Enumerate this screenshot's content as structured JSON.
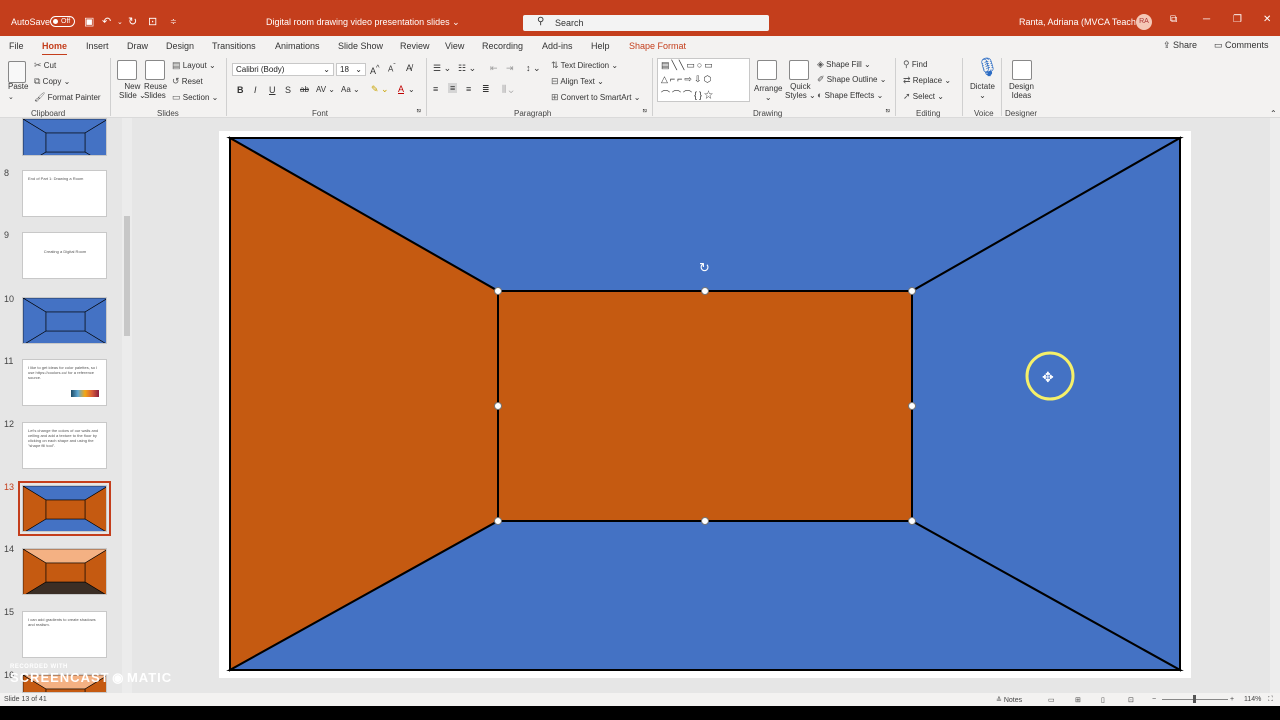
{
  "titlebar": {
    "autosave_label": "AutoSave",
    "autosave_state": "Off",
    "document_title": "Digital room drawing video presentation slides",
    "search_placeholder": "Search",
    "user_name": "Ranta, Adriana (MVCA Teacher)",
    "user_initials": "RA"
  },
  "menu": {
    "tabs": [
      "File",
      "Home",
      "Insert",
      "Draw",
      "Design",
      "Transitions",
      "Animations",
      "Slide Show",
      "Review",
      "View",
      "Recording",
      "Add-ins",
      "Help",
      "Shape Format"
    ],
    "active_tab": "Home",
    "share_label": "Share",
    "comments_label": "Comments"
  },
  "ribbon": {
    "clipboard": {
      "paste": "Paste",
      "cut": "Cut",
      "copy": "Copy",
      "format_painter": "Format Painter",
      "label": "Clipboard"
    },
    "slides": {
      "new_slide": "New Slide",
      "reuse_slides": "Reuse Slides",
      "layout": "Layout",
      "reset": "Reset",
      "section": "Section",
      "label": "Slides"
    },
    "font": {
      "font_name": "Calibri (Body)",
      "font_size": "18",
      "label": "Font"
    },
    "paragraph": {
      "text_direction": "Text Direction",
      "align_text": "Align Text",
      "convert_smartart": "Convert to SmartArt",
      "label": "Paragraph"
    },
    "drawing": {
      "arrange": "Arrange",
      "quick_styles": "Quick Styles",
      "shape_fill": "Shape Fill",
      "shape_outline": "Shape Outline",
      "shape_effects": "Shape Effects",
      "label": "Drawing"
    },
    "editing": {
      "find": "Find",
      "replace": "Replace",
      "select": "Select",
      "label": "Editing"
    },
    "voice": {
      "dictate": "Dictate",
      "label": "Voice"
    },
    "designer": {
      "design_ideas": "Design Ideas",
      "label": "Designer"
    }
  },
  "thumbnails": [
    {
      "num": "",
      "kind": "room-blue"
    },
    {
      "num": "8",
      "kind": "text",
      "text": "End of Part 1: Drawing a Room"
    },
    {
      "num": "9",
      "kind": "text-center",
      "text": "Creating a Digital Room"
    },
    {
      "num": "10",
      "kind": "room-blue"
    },
    {
      "num": "11",
      "kind": "text",
      "text": "I like to get ideas for color palettes, so I use https://coolors.co/ for a reference source."
    },
    {
      "num": "12",
      "kind": "text",
      "text": "Let's change the colors of our walls and ceiling and add a texture to the floor by clicking on each shape and using the \"shape fill tool\"."
    },
    {
      "num": "13",
      "kind": "room-orange-walls",
      "selected": true
    },
    {
      "num": "14",
      "kind": "room-peach"
    },
    {
      "num": "15",
      "kind": "text",
      "text": "I can add gradients to create shadows and realism."
    },
    {
      "num": "16",
      "kind": "partial"
    }
  ],
  "slide_colors": {
    "wall_blue": "#4472c4",
    "wall_orange": "#c55a11",
    "outline": "#000000"
  },
  "statusbar": {
    "slide_info": "Slide 13 of 41",
    "notes": "Notes",
    "zoom": "114%"
  },
  "watermark": {
    "line1": "RECORDED WITH",
    "line2": "SCREENCAST",
    "line3": "MATIC"
  }
}
